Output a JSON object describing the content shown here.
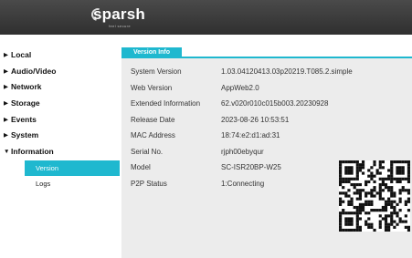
{
  "header": {
    "logo_text": "sparsh",
    "logo_tagline": "feel secure"
  },
  "sidebar": {
    "items": [
      {
        "label": "Local",
        "arrow": "▶"
      },
      {
        "label": "Audio/Video",
        "arrow": "▶"
      },
      {
        "label": "Network",
        "arrow": "▶"
      },
      {
        "label": "Storage",
        "arrow": "▶"
      },
      {
        "label": "Events",
        "arrow": "▶"
      },
      {
        "label": "System",
        "arrow": "▶"
      },
      {
        "label": "Information",
        "arrow": "▼"
      }
    ],
    "subitems": [
      {
        "label": "Version",
        "active": true
      },
      {
        "label": "Logs",
        "active": false
      }
    ]
  },
  "content": {
    "tab_label": "Version Info",
    "rows": [
      {
        "label": "System Version",
        "value": "1.03.04120413.03p20219.T085.2.simple"
      },
      {
        "label": "Web Version",
        "value": "AppWeb2.0"
      },
      {
        "label": "Extended Information",
        "value": "62.v020r010c015b003.20230928"
      },
      {
        "label": "Release Date",
        "value": "2023-08-26 10:53:51"
      },
      {
        "label": "MAC Address",
        "value": "18:74:e2:d1:ad:31"
      },
      {
        "label": "Serial No.",
        "value": "rjph00ebyqur"
      },
      {
        "label": "Model",
        "value": "SC-ISR20BP-W25"
      },
      {
        "label": "P2P Status",
        "value": "1:Connecting"
      }
    ]
  },
  "colors": {
    "accent": "#1fb8cf",
    "header_bg": "#3a3a3a",
    "content_bg": "#ececec"
  },
  "icons": {
    "qr": "qr-code-icon"
  }
}
